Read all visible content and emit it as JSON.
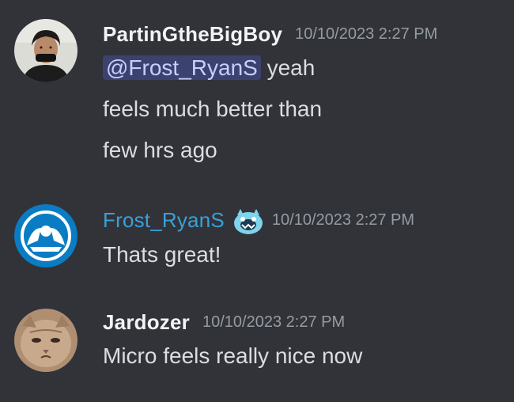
{
  "messages": [
    {
      "username": "PartinGtheBigBoy",
      "username_color": "#f2f3f5",
      "timestamp": "10/10/2023 2:27 PM",
      "avatar": "person-photo-avatar",
      "lines": [
        {
          "mention": "@Frost_RyanS",
          "text": " yeah"
        },
        {
          "text": "feels much better than"
        },
        {
          "text": "few hrs ago"
        }
      ]
    },
    {
      "username": "Frost_RyanS",
      "username_color": "#3aa0d8",
      "timestamp": "10/10/2023 2:27 PM",
      "avatar": "blue-logo-avatar",
      "badge": "blue-monster-emoji-icon",
      "lines": [
        {
          "text": "Thats great!"
        }
      ]
    },
    {
      "username": "Jardozer",
      "username_color": "#f2f3f5",
      "timestamp": "10/10/2023 2:27 PM",
      "avatar": "cat-photo-avatar",
      "lines": [
        {
          "text": "Micro feels really nice now"
        }
      ]
    }
  ],
  "colors": {
    "background": "#313338",
    "text": "#dbdee1",
    "timestamp": "#949ba4",
    "mention_bg": "#3c4270",
    "mention_text": "#c9cdfb"
  }
}
